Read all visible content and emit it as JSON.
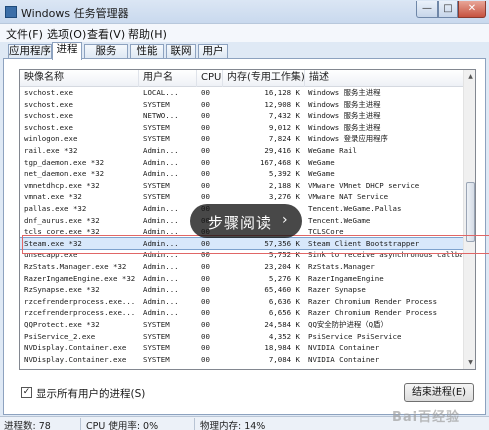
{
  "window": {
    "title": "Windows 任务管理器",
    "min_glyph": "—",
    "max_glyph": "□",
    "close_glyph": "✕"
  },
  "menu": [
    "文件(F)",
    "选项(O)",
    "查看(V)",
    "帮助(H)"
  ],
  "tabs": [
    {
      "label": "应用程序",
      "active": false
    },
    {
      "label": "进程",
      "active": true
    },
    {
      "label": "服务",
      "active": false
    },
    {
      "label": "性能",
      "active": false
    },
    {
      "label": "联网",
      "active": false
    },
    {
      "label": "用户",
      "active": false
    }
  ],
  "columns": {
    "name": "映像名称",
    "user": "用户名",
    "cpu": "CPU",
    "mem": "内存(专用工作集)",
    "desc": "描述"
  },
  "processes": [
    {
      "name": "svchost.exe",
      "user": "LOCAL...",
      "cpu": "00",
      "mem": "16,128 K",
      "desc": "Windows 服务主进程"
    },
    {
      "name": "svchost.exe",
      "user": "SYSTEM",
      "cpu": "00",
      "mem": "12,908 K",
      "desc": "Windows 服务主进程"
    },
    {
      "name": "svchost.exe",
      "user": "NETWO...",
      "cpu": "00",
      "mem": "7,432 K",
      "desc": "Windows 服务主进程"
    },
    {
      "name": "svchost.exe",
      "user": "SYSTEM",
      "cpu": "00",
      "mem": "9,012 K",
      "desc": "Windows 服务主进程"
    },
    {
      "name": "winlogon.exe",
      "user": "SYSTEM",
      "cpu": "00",
      "mem": "7,824 K",
      "desc": "Windows 登录应用程序"
    },
    {
      "name": "rail.exe *32",
      "user": "Admin...",
      "cpu": "00",
      "mem": "29,416 K",
      "desc": "WeGame Rail"
    },
    {
      "name": "tgp_daemon.exe *32",
      "user": "Admin...",
      "cpu": "00",
      "mem": "167,468 K",
      "desc": "WeGame"
    },
    {
      "name": "net_daemon.exe *32",
      "user": "Admin...",
      "cpu": "00",
      "mem": "5,392 K",
      "desc": "WeGame"
    },
    {
      "name": "vmnetdhcp.exe *32",
      "user": "SYSTEM",
      "cpu": "00",
      "mem": "2,188 K",
      "desc": "VMware VMnet DHCP service"
    },
    {
      "name": "vmnat.exe *32",
      "user": "SYSTEM",
      "cpu": "00",
      "mem": "3,276 K",
      "desc": "VMware NAT Service"
    },
    {
      "name": "pallas.exe *32",
      "user": "Admin...",
      "cpu": "00",
      "mem": "",
      "desc": "Tencent.WeGame.Pallas"
    },
    {
      "name": "dnf_aurus.exe *32",
      "user": "Admin...",
      "cpu": "00",
      "mem": "",
      "desc": "Tencent.WeGame"
    },
    {
      "name": "tcls_core.exe *32",
      "user": "Admin...",
      "cpu": "00",
      "mem": "",
      "desc": "TCLSCore"
    },
    {
      "name": "Steam.exe *32",
      "user": "Admin...",
      "cpu": "00",
      "mem": "57,356 K",
      "desc": "Steam Client Bootstrapper",
      "selected": true
    },
    {
      "name": "unsecapp.exe",
      "user": "Admin...",
      "cpu": "00",
      "mem": "5,752 K",
      "desc": "Sink to receive asynchronous callbac"
    },
    {
      "name": "RzStats.Manager.exe *32",
      "user": "Admin...",
      "cpu": "00",
      "mem": "23,204 K",
      "desc": "RzStats.Manager"
    },
    {
      "name": "RazerIngameEngine.exe *32",
      "user": "Admin...",
      "cpu": "00",
      "mem": "5,276 K",
      "desc": "RazerIngameEngine"
    },
    {
      "name": "RzSynapse.exe *32",
      "user": "Admin...",
      "cpu": "00",
      "mem": "65,460 K",
      "desc": "Razer Synapse"
    },
    {
      "name": "rzcefrenderprocess.exe...",
      "user": "Admin...",
      "cpu": "00",
      "mem": "6,636 K",
      "desc": "Razer Chromium Render Process"
    },
    {
      "name": "rzcefrenderprocess.exe...",
      "user": "Admin...",
      "cpu": "00",
      "mem": "6,656 K",
      "desc": "Razer Chromium Render Process"
    },
    {
      "name": "QQProtect.exe *32",
      "user": "SYSTEM",
      "cpu": "00",
      "mem": "24,584 K",
      "desc": "QQ安全防护进程（Q盾）"
    },
    {
      "name": "PsiService_2.exe",
      "user": "SYSTEM",
      "cpu": "00",
      "mem": "4,352 K",
      "desc": "PsiService PsiService"
    },
    {
      "name": "NVDisplay.Container.exe",
      "user": "SYSTEM",
      "cpu": "00",
      "mem": "18,984 K",
      "desc": "NVIDIA Container"
    },
    {
      "name": "NVDisplay.Container.exe",
      "user": "SYSTEM",
      "cpu": "00",
      "mem": "7,084 K",
      "desc": "NVIDIA Container"
    },
    {
      "name": "",
      "user": "",
      "cpu": "",
      "mem": "",
      "desc": ""
    }
  ],
  "overlay": {
    "text": "步骤阅读",
    "arrow": "›"
  },
  "show_all_users": {
    "label": "显示所有用户的进程(S)",
    "checked": true,
    "mark": "✓"
  },
  "end_process": "结束进程(E)",
  "status": {
    "process_count": "进程数: 78",
    "cpu_usage": "CPU 使用率: 0%",
    "physical_memory": "物理内存: 14%"
  },
  "watermark": "Bai百经验"
}
